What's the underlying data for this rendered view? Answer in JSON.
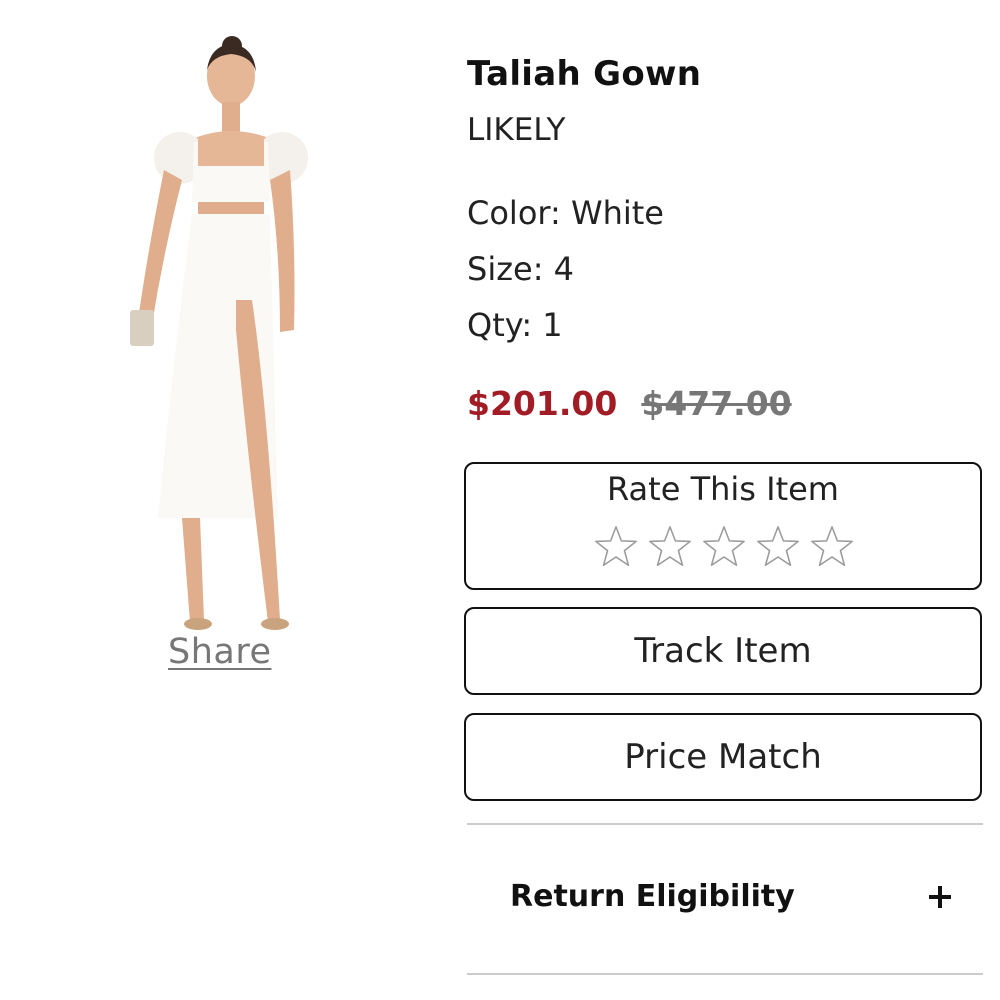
{
  "product": {
    "name": "Taliah Gown",
    "brand": "LIKELY",
    "color": "Color: White",
    "size": "Size: 4",
    "qty": "Qty: 1",
    "sale_price": "$201.00",
    "original_price": "$477.00",
    "image_icon": "white-gown-photo"
  },
  "share_label": "Share",
  "rating": {
    "title": "Rate This Item",
    "stars_total": 5,
    "stars_filled": 0,
    "star_icon": "star-outline-icon"
  },
  "actions": {
    "track_label": "Track Item",
    "price_match_label": "Price Match"
  },
  "accordion": {
    "return_label": "Return Eligibility",
    "expand_icon": "plus-icon"
  },
  "colors": {
    "sale_price": "#a11c24",
    "original_price": "#777777",
    "border": "#111111",
    "divider": "#cccccc"
  }
}
